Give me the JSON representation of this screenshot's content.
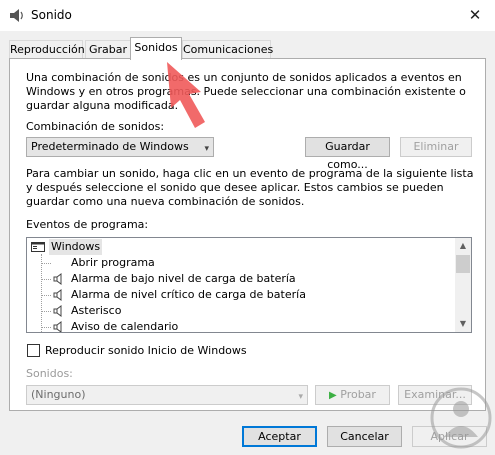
{
  "window": {
    "title": "Sonido",
    "close_glyph": "✕"
  },
  "tabs": [
    {
      "label": "Reproducción",
      "active": false
    },
    {
      "label": "Grabar",
      "active": false
    },
    {
      "label": "Sonidos",
      "active": true
    },
    {
      "label": "Comunicaciones",
      "active": false
    }
  ],
  "intro_lines": [
    "Una combinación de sonidos es un conjunto de sonidos aplicados a eventos en",
    "Windows y en otros programas. Puede seleccionar una combinación existente o",
    "guardar alguna modificada."
  ],
  "scheme": {
    "label": "Combinación de sonidos:",
    "selected": "Predeterminado de Windows",
    "save_button": "Guardar como...",
    "delete_button": "Eliminar"
  },
  "instructions_lines": [
    "Para cambiar un sonido, haga clic en un evento de programa de la siguiente lista",
    "y después seleccione el sonido que desee aplicar. Estos cambios se pueden",
    "guardar como una nueva combinación de sonidos."
  ],
  "events": {
    "label": "Eventos de programa:",
    "group": "Windows",
    "items": [
      {
        "label": "Abrir programa",
        "has_sound": false
      },
      {
        "label": "Alarma de bajo nivel de carga de batería",
        "has_sound": true
      },
      {
        "label": "Alarma de nivel crítico de carga de batería",
        "has_sound": true
      },
      {
        "label": "Asterisco",
        "has_sound": true
      },
      {
        "label": "Aviso de calendario",
        "has_sound": true
      }
    ]
  },
  "startup_checkbox": {
    "label": "Reproducir sonido Inicio de Windows",
    "checked": false
  },
  "sounds": {
    "label": "Sonidos:",
    "selected": "(Ninguno)",
    "test_button": "Probar",
    "browse_button": "Examinar..."
  },
  "footer": {
    "ok": "Aceptar",
    "cancel": "Cancelar",
    "apply": "Aplicar"
  },
  "colors": {
    "accent": "#0078d7",
    "annotation_arrow": "#f05a5a",
    "play_icon": "#3cb043"
  }
}
